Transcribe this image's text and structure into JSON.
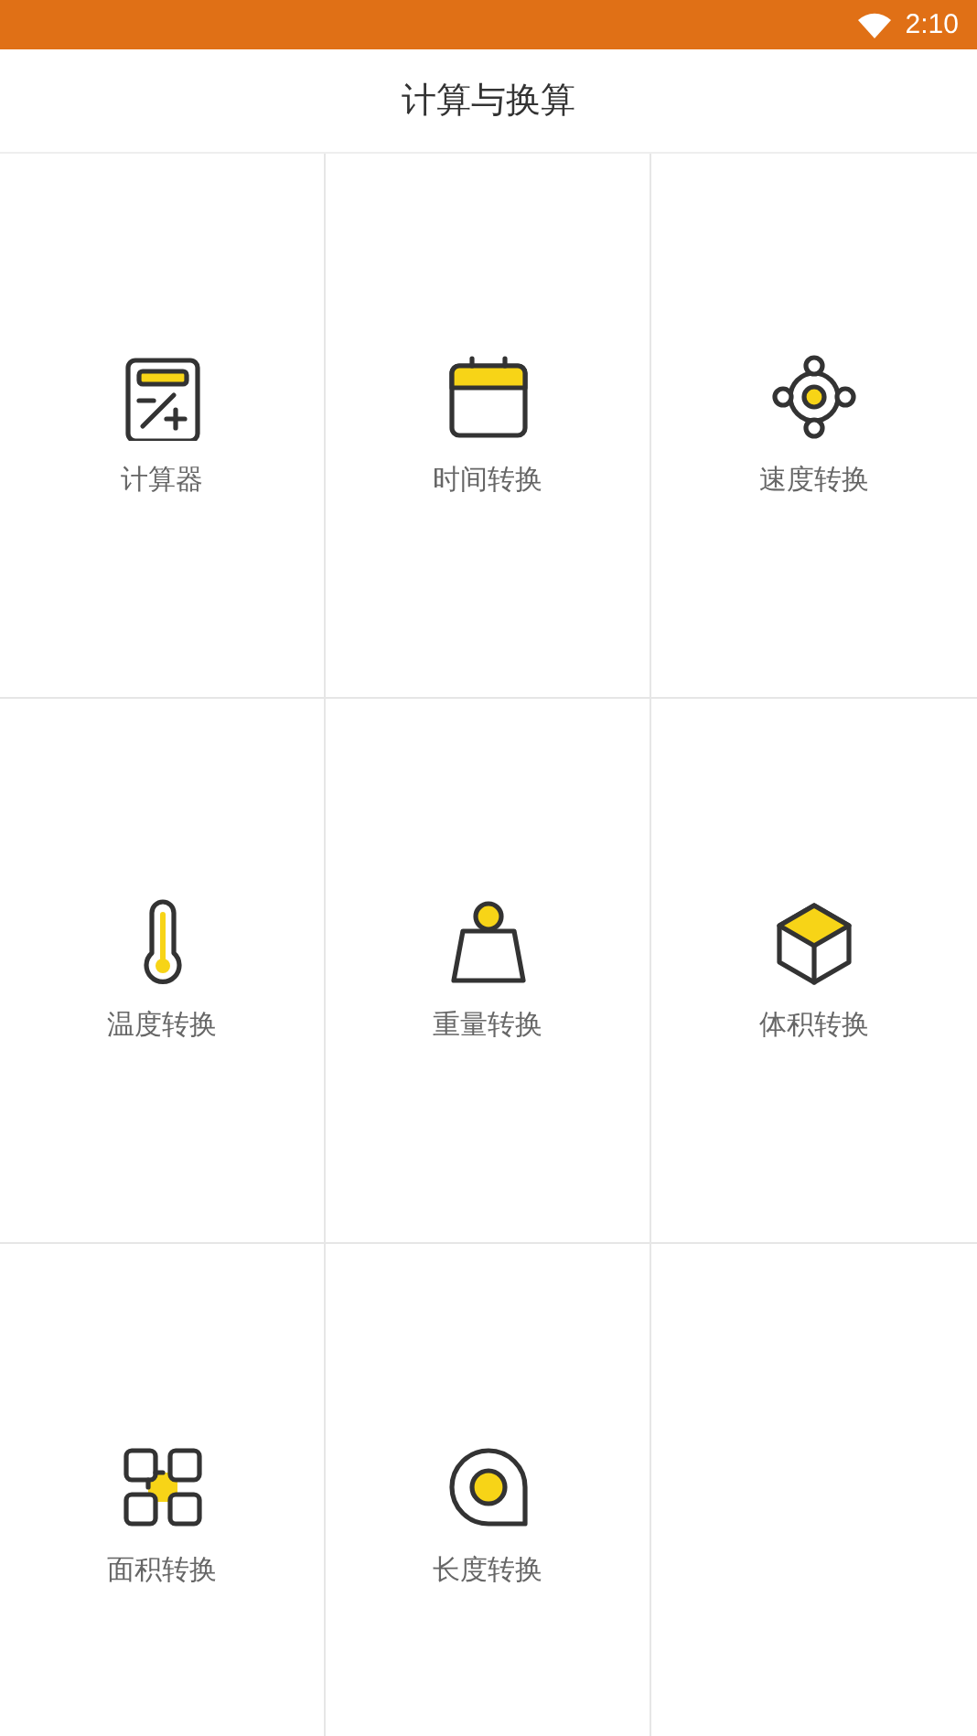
{
  "status_bar": {
    "time": "2:10"
  },
  "header": {
    "title": "计算与换算"
  },
  "tools": [
    {
      "label": "计算器",
      "kind": "calculator"
    },
    {
      "label": "时间转换",
      "kind": "calendar"
    },
    {
      "label": "速度转换",
      "kind": "orbit"
    },
    {
      "label": "温度转换",
      "kind": "thermometer"
    },
    {
      "label": "重量转换",
      "kind": "weight"
    },
    {
      "label": "体积转换",
      "kind": "cube"
    },
    {
      "label": "面积转换",
      "kind": "area"
    },
    {
      "label": "长度转换",
      "kind": "tape"
    },
    {
      "kind": "empty"
    }
  ]
}
